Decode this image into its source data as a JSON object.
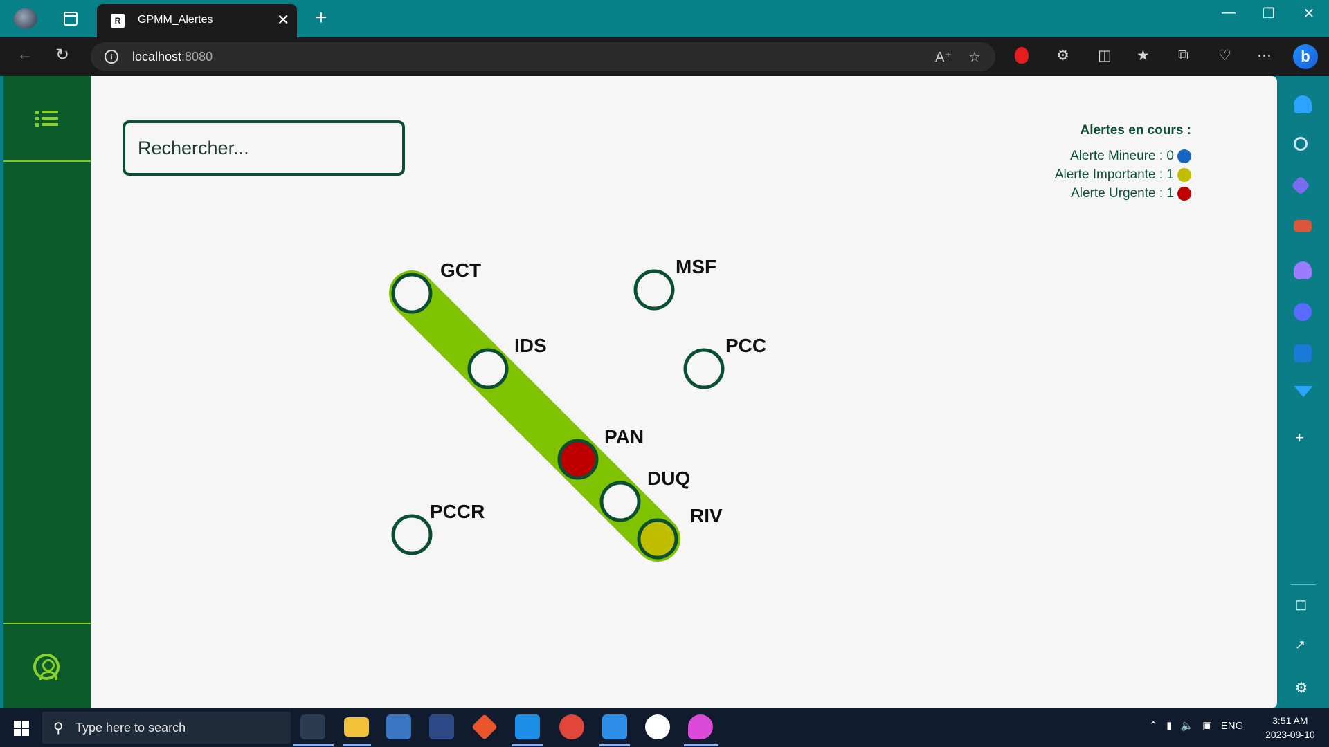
{
  "browser": {
    "tab_title": "GPMM_Alertes",
    "tab_favicon": "R",
    "url_host": "localhost",
    "url_port": ":8080",
    "new_tab_symbol": "+",
    "close_symbol": "✕"
  },
  "app": {
    "search": {
      "placeholder": "Rechercher..."
    },
    "alerts": {
      "title": "Alertes en cours :",
      "items": [
        {
          "label": "Alerte Mineure : 0",
          "color": "#1565c0"
        },
        {
          "label": "Alerte Importante : 1",
          "color": "#bfbf00"
        },
        {
          "label": "Alerte Urgente : 1",
          "color": "#c00000"
        }
      ]
    },
    "colors": {
      "sidebar_bg": "#0b5b2b",
      "accent_green": "#7fc200",
      "station_ring": "#0b4f32"
    },
    "stations": [
      {
        "name": "GCT",
        "status": "normal",
        "on_line": true
      },
      {
        "name": "IDS",
        "status": "normal",
        "on_line": true
      },
      {
        "name": "PAN",
        "status": "urgente",
        "on_line": true
      },
      {
        "name": "DUQ",
        "status": "normal",
        "on_line": true
      },
      {
        "name": "RIV",
        "status": "importante",
        "on_line": true
      },
      {
        "name": "MSF",
        "status": "normal",
        "on_line": false
      },
      {
        "name": "PCC",
        "status": "normal",
        "on_line": false
      },
      {
        "name": "PCCR",
        "status": "normal",
        "on_line": false
      }
    ]
  },
  "taskbar": {
    "search_placeholder": "Type here to search",
    "language": "ENG",
    "time": "3:51 AM",
    "date": "2023-09-10"
  }
}
